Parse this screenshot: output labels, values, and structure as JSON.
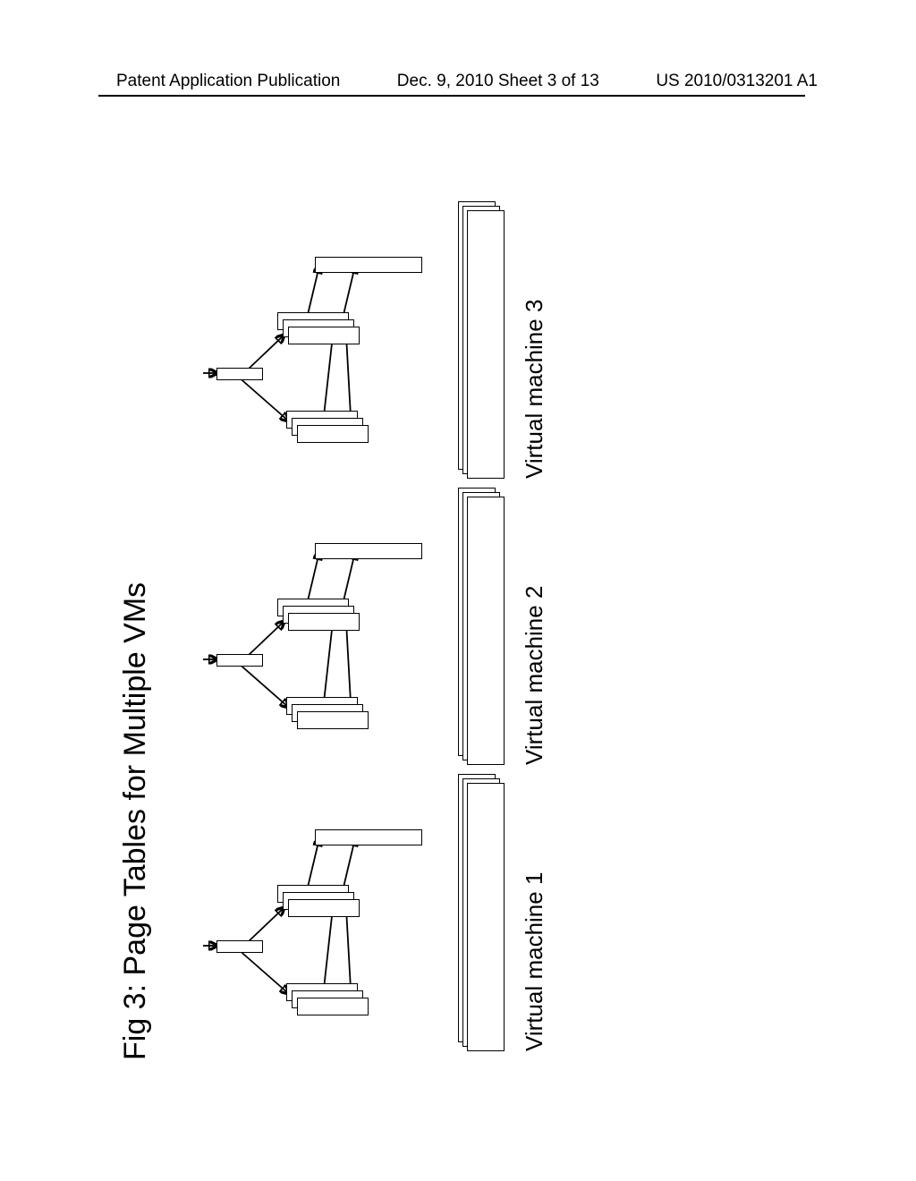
{
  "header": {
    "left": "Patent Application Publication",
    "center": "Dec. 9, 2010  Sheet 3 of 13",
    "right": "US 2010/0313201 A1"
  },
  "figure": {
    "title": "Fig 3: Page Tables for Multiple VMs"
  },
  "vms": {
    "vm1": {
      "label": "Virtual machine 1"
    },
    "vm2": {
      "label": "Virtual machine 2"
    },
    "vm3": {
      "label": "Virtual machine 3"
    }
  }
}
